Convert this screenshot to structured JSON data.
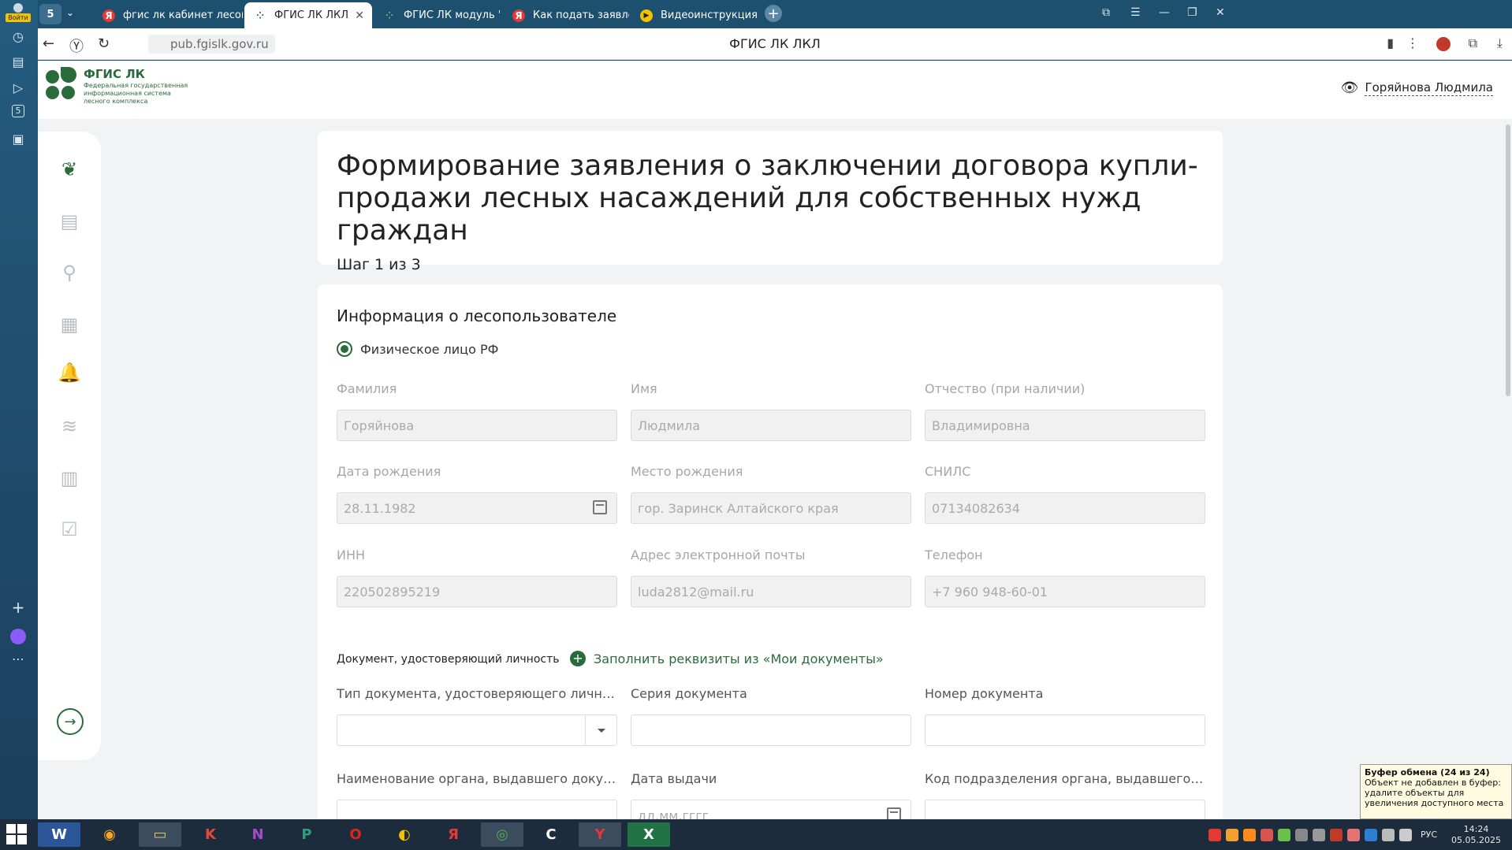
{
  "browser": {
    "login_label": "Войти",
    "tab_count": "5",
    "tabs": [
      {
        "label": "фгис лк кабинет лесопол",
        "icon": "yandex-icon"
      },
      {
        "label": "ФГИС ЛК ЛКЛ",
        "icon": "fgis-icon",
        "active": true
      },
      {
        "label": "ФГИС ЛК модуль 'Публич",
        "icon": "fgis-icon"
      },
      {
        "label": "Как подать заявление на",
        "icon": "yandex-icon"
      },
      {
        "label": "Видеоинструкция ФГИС",
        "icon": "play-icon"
      }
    ],
    "url": "pub.fgislk.gov.ru",
    "page_title": "ФГИС ЛК ЛКЛ"
  },
  "header": {
    "logo_title": "ФГИС ЛК",
    "logo_subtitle": "Федеральная государственная информационная система лесного комплекса",
    "user_name": "Горяйнова Людмила"
  },
  "form": {
    "title": "Формирование заявления о заключении договора купли-продажи лесных насаждений для собственных нужд граждан",
    "step": "Шаг 1 из 3",
    "section_title": "Информация о лесопользователе",
    "person_type": "Физическое лицо РФ",
    "fields": {
      "last_name": {
        "label": "Фамилия",
        "value": "Горяйнова"
      },
      "first_name": {
        "label": "Имя",
        "value": "Людмила"
      },
      "patronymic": {
        "label": "Отчество (при наличии)",
        "value": "Владимировна"
      },
      "birth_date": {
        "label": "Дата рождения",
        "value": "28.11.1982"
      },
      "birth_place": {
        "label": "Место рождения",
        "value": "гор. Заринск Алтайского края"
      },
      "snils": {
        "label": "СНИЛС",
        "value": "07134082634"
      },
      "inn": {
        "label": "ИНН",
        "value": "220502895219"
      },
      "email": {
        "label": "Адрес электронной почты",
        "value": "luda2812@mail.ru"
      },
      "phone": {
        "label": "Телефон",
        "value": "+7 960 948-60-01"
      },
      "doc_type": {
        "label": "Тип документа, удостоверяющего личнос...",
        "value": ""
      },
      "doc_series": {
        "label": "Серия документа",
        "value": ""
      },
      "doc_number": {
        "label": "Номер документа",
        "value": ""
      },
      "issuer": {
        "label": "Наименование органа, выдавшего докум...",
        "value": ""
      },
      "issue_date": {
        "label": "Дата выдачи",
        "placeholder": "дд.мм.гггг"
      },
      "issuer_code": {
        "label": "Код подразделения органа, выдавшего д...",
        "value": ""
      }
    },
    "doc_section_label": "Документ, удостоверяющий личность",
    "fill_link": "Заполнить реквизиты из «Мои документы»"
  },
  "tooltip": {
    "title": "Буфер обмена (24 из 24)",
    "text": "Объект не добавлен в буфер: удалите объекты для увеличения доступного места"
  },
  "taskbar": {
    "language": "РУС",
    "time": "14:24",
    "date": "05.05.2025"
  },
  "colors": {
    "brand_green": "#2a6b3c",
    "browser_blue": "#1d4f6f"
  }
}
